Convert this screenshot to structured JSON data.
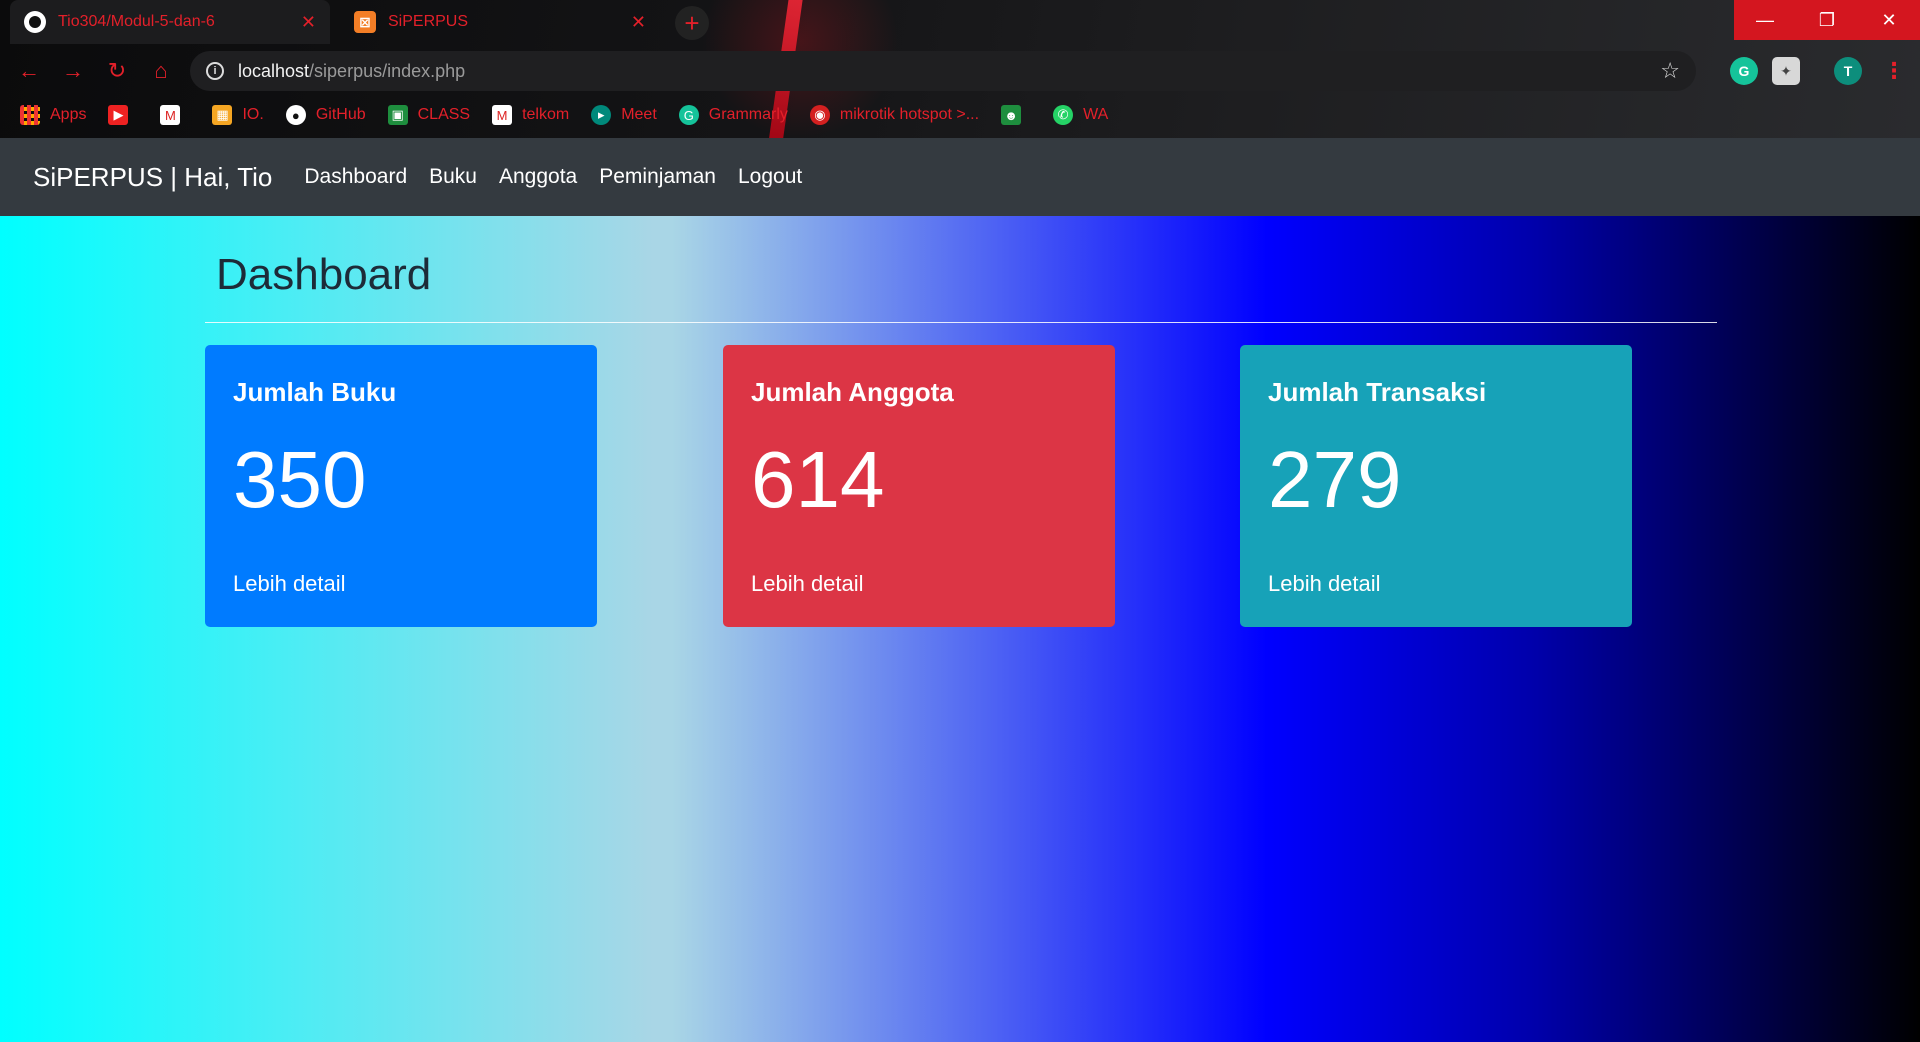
{
  "browser": {
    "tabs": [
      {
        "label": "Tio304/Modul-5-dan-6",
        "icon": "github-icon"
      },
      {
        "label": "SiPERPUS",
        "icon": "xampp-icon"
      }
    ],
    "close_glyph": "✕",
    "new_tab_glyph": "+",
    "address": {
      "host": "localhost",
      "path": "/siperpus/index.php"
    },
    "avatar_letter": "T",
    "bookmarks": [
      "Apps",
      "",
      "",
      "IO.",
      "GitHub",
      "CLASS",
      "telkom",
      "Meet",
      "Grammarly",
      "mikrotik hotspot >...",
      "",
      "WA"
    ],
    "accent_color": "#e3202a"
  },
  "navbar": {
    "brand": "SiPERPUS | Hai, Tio",
    "links": [
      "Dashboard",
      "Buku",
      "Anggota",
      "Peminjaman",
      "Logout"
    ]
  },
  "page": {
    "title": "Dashboard"
  },
  "cards": [
    {
      "title": "Jumlah Buku",
      "value": "350",
      "link": "Lebih detail",
      "color": "#007bff"
    },
    {
      "title": "Jumlah Anggota",
      "value": "614",
      "link": "Lebih detail",
      "color": "#dc3545"
    },
    {
      "title": "Jumlah Transaksi",
      "value": "279",
      "link": "Lebih detail",
      "color": "#17a2b8"
    }
  ]
}
